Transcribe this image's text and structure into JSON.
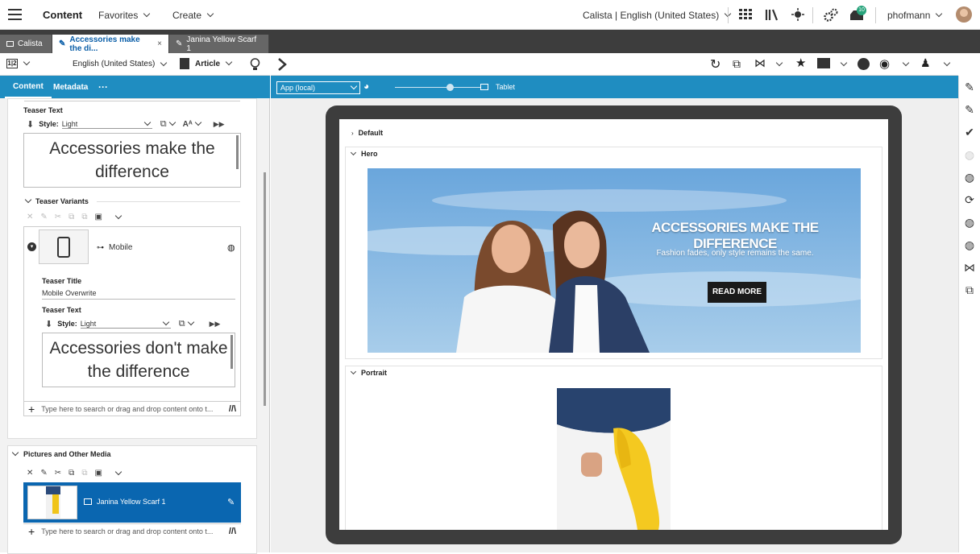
{
  "topbar": {
    "app_title": "Content",
    "favorites": "Favorites",
    "create": "Create",
    "site_locale": "Calista | English (United States)",
    "notification_count": "10",
    "user": "phofmann"
  },
  "tabs": [
    {
      "label": "Calista"
    },
    {
      "label": "Accessories make the di..."
    },
    {
      "label": "Janina Yellow Scarf 1"
    }
  ],
  "left_toolbar": {
    "locale": "English (United States)",
    "doctype": "Article"
  },
  "left_tabs": {
    "content": "Content",
    "metadata": "Metadata",
    "more": "···"
  },
  "teaser_text": {
    "label": "Teaser Text",
    "style_label": "Style:",
    "style_value": "Light",
    "text": "Accessories make the difference"
  },
  "teaser_variants": {
    "label": "Teaser Variants",
    "variant_name": "Mobile",
    "title_label": "Teaser Title",
    "title_value": "Mobile Overwrite",
    "text_label": "Teaser Text",
    "style_label": "Style:",
    "style_value": "Light",
    "text": "Accessories don't make the difference",
    "link_placeholder": "Type here to search or drag and drop content onto t..."
  },
  "pictures": {
    "label": "Pictures and Other Media",
    "item": "Janina Yellow Scarf 1",
    "link_placeholder": "Type here to search or drag and drop content onto t..."
  },
  "preview_toolbar": {
    "app_select": "App (local)",
    "device": "Tablet",
    "zoom_level": 0.6
  },
  "preview": {
    "sections": [
      "Default",
      "Hero",
      "Portrait"
    ],
    "hero_headline": "ACCESSORIES MAKE THE DIFFERENCE",
    "hero_sub": "Fashion fades, only style remains the same.",
    "hero_button": "READ MORE"
  },
  "colors": {
    "accent": "#1f8dc1",
    "selected": "#0a66b0",
    "topbar_dark": "#3d3d3d"
  }
}
